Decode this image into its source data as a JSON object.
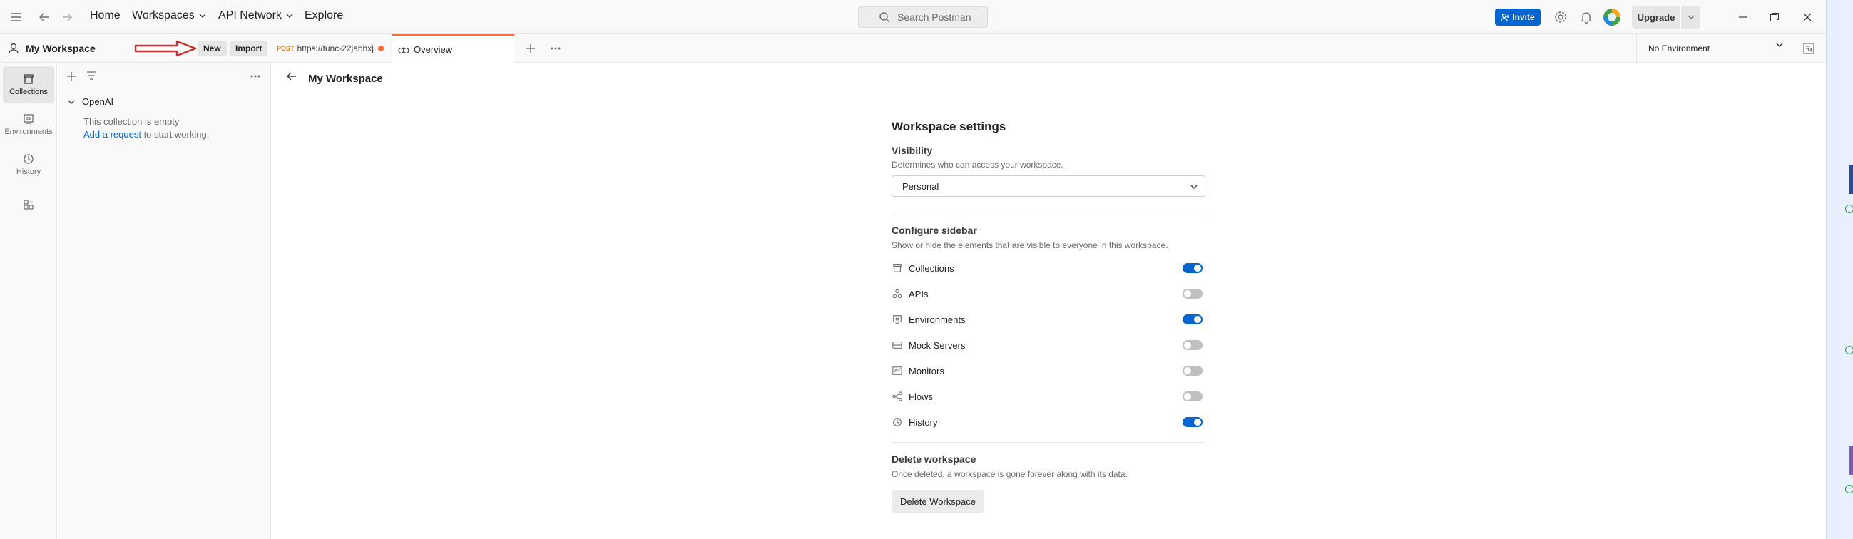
{
  "topbar": {
    "nav": {
      "home": "Home",
      "workspaces": "Workspaces",
      "api_network": "API Network",
      "explore": "Explore"
    },
    "search_placeholder": "Search Postman",
    "invite_label": "Invite",
    "upgrade_label": "Upgrade"
  },
  "workspace_header": {
    "name": "My Workspace",
    "new_label": "New",
    "import_label": "Import"
  },
  "rail": {
    "items": [
      {
        "label": "Collections",
        "icon": "collections-icon",
        "active": true
      },
      {
        "label": "Environments",
        "icon": "environments-icon",
        "active": false
      },
      {
        "label": "History",
        "icon": "history-icon",
        "active": false
      }
    ]
  },
  "sidebar": {
    "collection_name": "OpenAI",
    "empty_text": "This collection is empty",
    "add_request_link": "Add a request",
    "add_request_suffix": " to start working."
  },
  "tabs": {
    "request": {
      "method": "POST",
      "title": "https://func-22jabhxj"
    },
    "overview": {
      "title": "Overview"
    },
    "environment": "No Environment"
  },
  "main": {
    "title": "My Workspace",
    "settings_title": "Workspace settings",
    "visibility": {
      "heading": "Visibility",
      "description": "Determines who can access your workspace.",
      "selected": "Personal"
    },
    "sidebar_config": {
      "heading": "Configure sidebar",
      "description": "Show or hide the elements that are visible to everyone in this workspace.",
      "items": [
        {
          "label": "Collections",
          "enabled": true,
          "icon": "collections-icon"
        },
        {
          "label": "APIs",
          "enabled": false,
          "icon": "apis-icon"
        },
        {
          "label": "Environments",
          "enabled": true,
          "icon": "environments-icon"
        },
        {
          "label": "Mock Servers",
          "enabled": false,
          "icon": "mock-servers-icon"
        },
        {
          "label": "Monitors",
          "enabled": false,
          "icon": "monitors-icon"
        },
        {
          "label": "Flows",
          "enabled": false,
          "icon": "flows-icon"
        },
        {
          "label": "History",
          "enabled": true,
          "icon": "history-icon"
        }
      ]
    },
    "delete": {
      "heading": "Delete workspace",
      "description": "Once deleted, a workspace is gone forever along with its data.",
      "button": "Delete Workspace"
    }
  },
  "colors": {
    "accent": "#0265d2",
    "orange": "#ff6c37",
    "annotation_arrow": "#d32f2f"
  }
}
